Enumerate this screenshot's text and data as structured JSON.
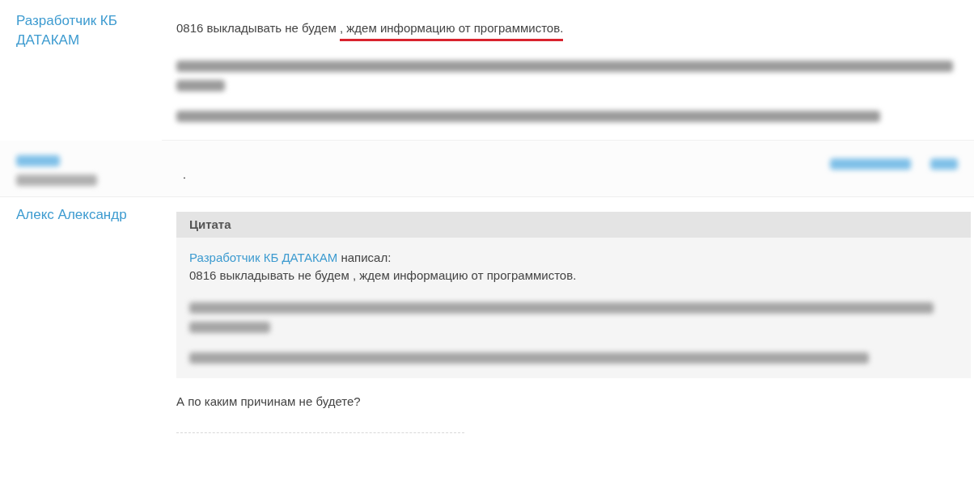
{
  "posts": [
    {
      "kind": "post",
      "author": "Разработчик КБ ДАТАКАМ",
      "text_before": "0816 выкладывать не будем ",
      "text_marked": ", ждем информацию от программистов."
    },
    {
      "kind": "hidden",
      "text": "."
    },
    {
      "kind": "reply",
      "author": "Алекс Александр",
      "quote": {
        "title": "Цитата",
        "author": "Разработчик КБ ДАТАКАМ",
        "wrote": "написал:",
        "text": "0816 выкладывать не будем , ждем информацию от программистов."
      },
      "text": "А по каким причинам не будете?"
    }
  ]
}
